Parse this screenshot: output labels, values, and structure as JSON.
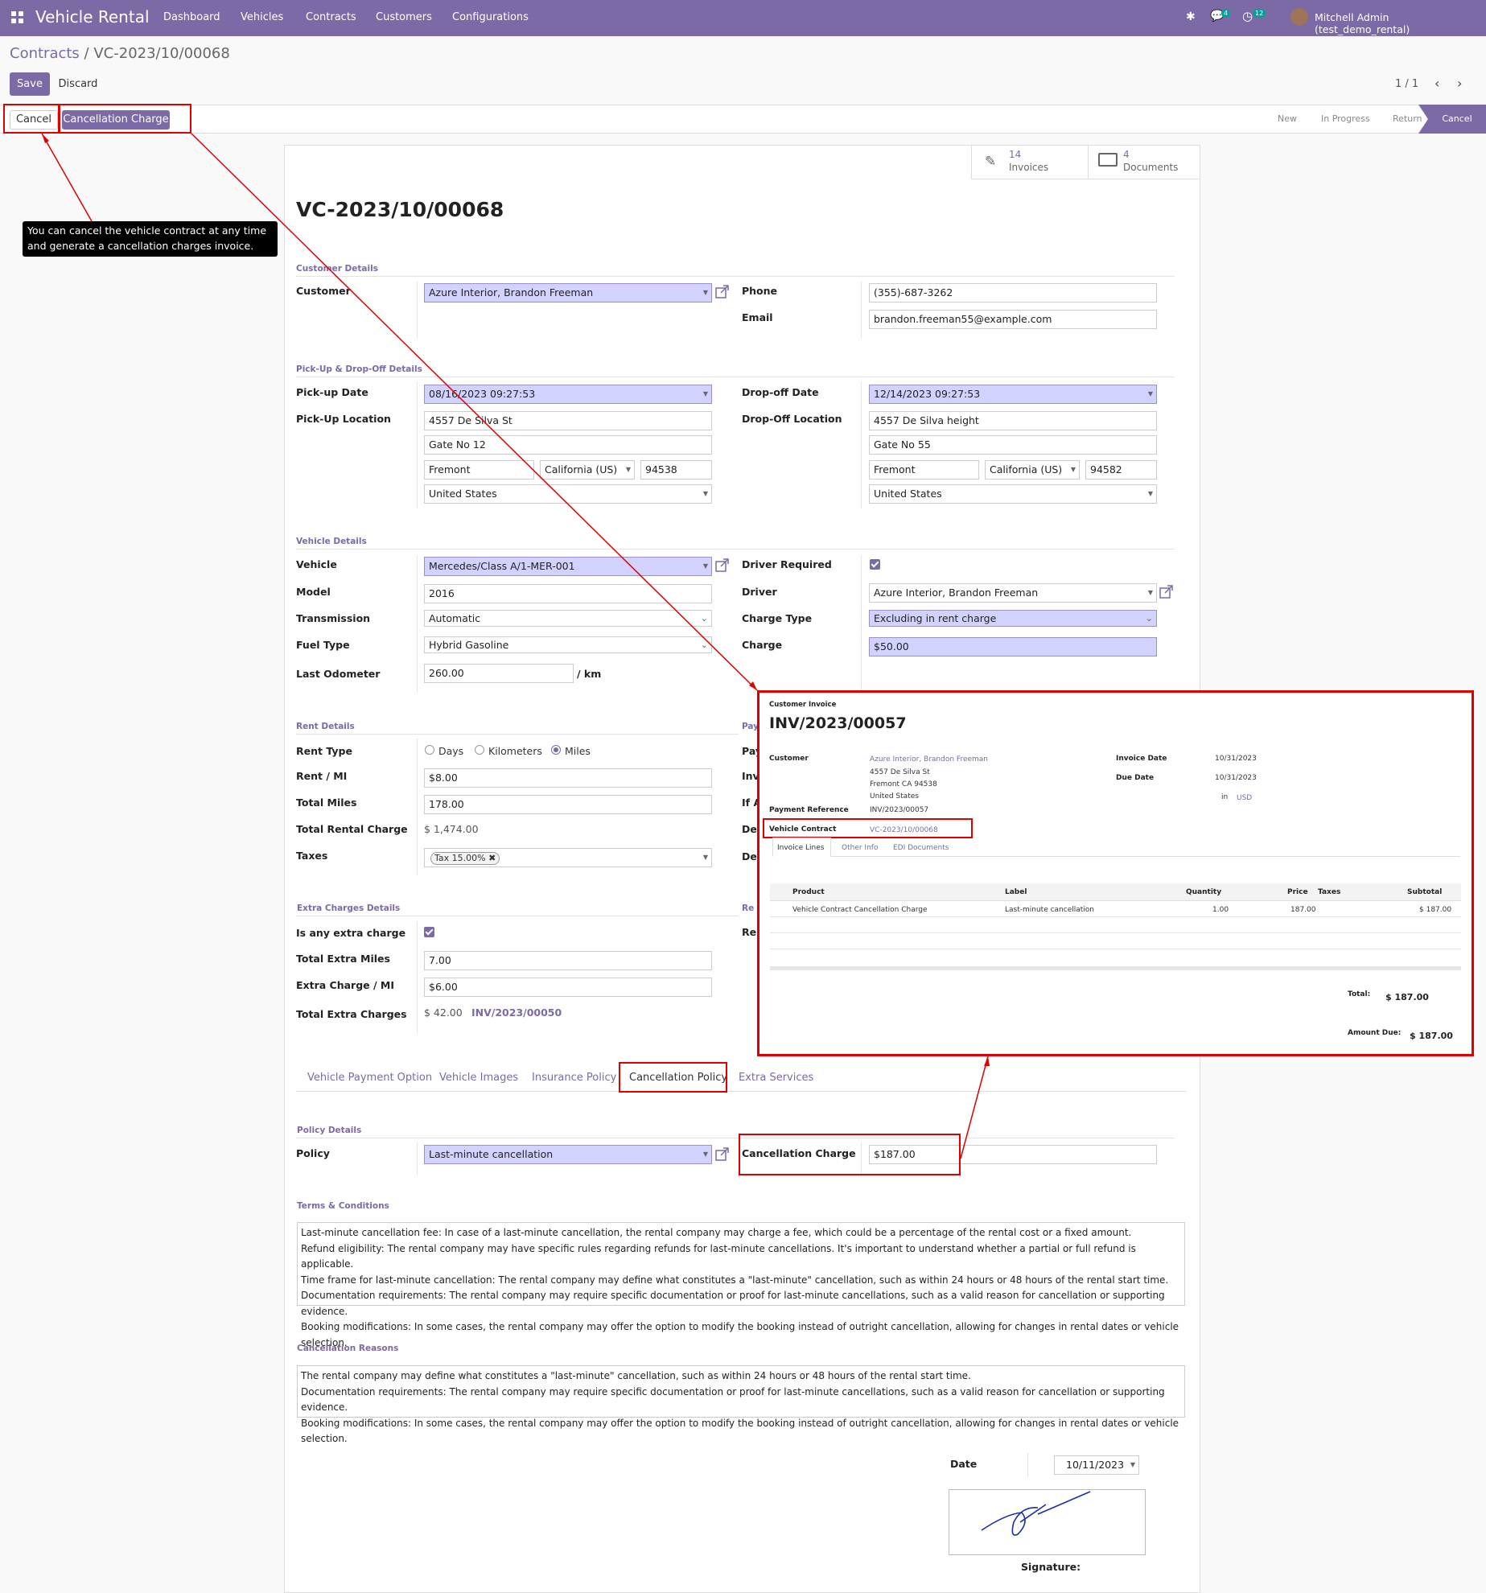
{
  "app": {
    "name": "Vehicle Rental"
  },
  "nav": {
    "menus": [
      "Dashboard",
      "Vehicles",
      "Contracts",
      "Customers",
      "Configurations"
    ],
    "messages_badge": "4",
    "activity_badge": "12",
    "user": "Mitchell Admin (test_demo_rental)"
  },
  "breadcrumb": {
    "parent": "Contracts",
    "sep": "/",
    "current": "VC-2023/10/00068"
  },
  "actions": {
    "save": "Save",
    "discard": "Discard",
    "cancel": "Cancel",
    "cancellation_charge": "Cancellation Charge"
  },
  "pager": "1 / 1",
  "stages": [
    "New",
    "In Progress",
    "Return",
    "Cancel"
  ],
  "smart_buttons": {
    "invoices_count": "14",
    "invoices_label": "Invoices",
    "documents_count": "4",
    "documents_label": "Documents"
  },
  "tooltip": "You can cancel the vehicle contract at any time and generate a cancellation charges invoice.",
  "record": {
    "title": "VC-2023/10/00068"
  },
  "customer_details": {
    "section": "Customer Details",
    "customer_label": "Customer",
    "customer": "Azure Interior, Brandon Freeman",
    "phone_label": "Phone",
    "phone": "(355)-687-3262",
    "email_label": "Email",
    "email": "brandon.freeman55@example.com"
  },
  "pickup": {
    "section": "Pick-Up & Drop-Off Details",
    "pickup_date_label": "Pick-up Date",
    "pickup_date": "08/16/2023 09:27:53",
    "pickup_loc_label": "Pick-Up Location",
    "p_street": "4557 De Silva St",
    "p_street2": "Gate No 12",
    "p_city": "Fremont",
    "p_state": "California (US)",
    "p_zip": "94538",
    "p_country": "United States",
    "drop_date_label": "Drop-off Date",
    "drop_date": "12/14/2023 09:27:53",
    "drop_loc_label": "Drop-Off Location",
    "d_street": "4557 De Silva height",
    "d_street2": "Gate No 55",
    "d_city": "Fremont",
    "d_state": "California (US)",
    "d_zip": "94582",
    "d_country": "United States"
  },
  "vehicle": {
    "section": "Vehicle Details",
    "vehicle_label": "Vehicle",
    "vehicle": "Mercedes/Class A/1-MER-001",
    "model_label": "Model",
    "model": "2016",
    "transmission_label": "Transmission",
    "transmission": "Automatic",
    "fuel_label": "Fuel Type",
    "fuel": "Hybrid Gasoline",
    "odo_label": "Last Odometer",
    "odo": "260.00",
    "odo_unit": "/ km",
    "driver_req_label": "Driver Required",
    "driver_label": "Driver",
    "driver": "Azure Interior, Brandon Freeman",
    "charge_type_label": "Charge Type",
    "charge_type": "Excluding in rent charge",
    "charge_label": "Charge",
    "charge": "$50.00"
  },
  "rent": {
    "section": "Rent Details",
    "rent_type_label": "Rent Type",
    "opt_days": "Days",
    "opt_km": "Kilometers",
    "opt_miles": "Miles",
    "rate_label": "Rent / MI",
    "rate": "$8.00",
    "total_miles_label": "Total Miles",
    "total_miles": "178.00",
    "total_rent_label": "Total Rental Charge",
    "total_rent": "$ 1,474.00",
    "taxes_label": "Taxes",
    "tax_tag": "Tax 15.00%",
    "right_cut_1": "Pay",
    "right_cut_2": "Pay",
    "right_cut_3": "Inv",
    "right_cut_4": "If A",
    "right_cut_5": "De",
    "right_cut_6": "De",
    "right_cut_7": "Re",
    "right_cut_8": "Re"
  },
  "extra": {
    "section": "Extra Charges Details",
    "is_extra_label": "Is any extra charge",
    "miles_label": "Total Extra Miles",
    "miles": "7.00",
    "rate_label": "Extra Charge / MI",
    "rate": "$6.00",
    "total_label": "Total Extra Charges",
    "total": "$ 42.00",
    "invoice_ref": "INV/2023/00050"
  },
  "tabs": [
    "Vehicle Payment Option",
    "Vehicle Images",
    "Insurance Policy",
    "Cancellation Policy",
    "Extra Services"
  ],
  "policy": {
    "section": "Policy Details",
    "policy_label": "Policy",
    "policy": "Last-minute cancellation",
    "cancel_charge_label": "Cancellation Charge",
    "cancel_charge": "$187.00"
  },
  "terms": {
    "section": "Terms & Conditions",
    "lines": [
      "Last-minute cancellation fee: In case of a last-minute cancellation, the rental company may charge a fee, which could be a percentage of the rental cost or a fixed amount.",
      "Refund eligibility: The rental company may have specific rules regarding refunds for last-minute cancellations. It's important to understand whether a partial or full refund is applicable.",
      "Time frame for last-minute cancellation: The rental company may define what constitutes a \"last-minute\" cancellation, such as within 24 hours or 48 hours of the rental start time.",
      "Documentation requirements: The rental company may require specific documentation or proof for last-minute cancellations, such as a valid reason for cancellation or supporting evidence.",
      "Booking modifications: In some cases, the rental company may offer the option to modify the booking instead of outright cancellation, allowing for changes in rental dates or vehicle selection."
    ]
  },
  "reasons": {
    "section": "Cancellation Reasons",
    "lines": [
      "The rental company may define what constitutes a \"last-minute\" cancellation, such as within 24 hours or 48 hours of the rental start time.",
      "Documentation requirements: The rental company may require specific documentation or proof for last-minute cancellations, such as a valid reason for cancellation or supporting evidence.",
      "Booking modifications: In some cases, the rental company may offer the option to modify the booking instead of outright cancellation, allowing for changes in rental dates or vehicle selection."
    ]
  },
  "signoff": {
    "date_label": "Date",
    "date": "10/11/2023",
    "signature_label": "Signature:"
  },
  "invoice": {
    "kind": "Customer Invoice",
    "number": "INV/2023/00057",
    "customer_label": "Customer",
    "customer": "Azure Interior, Brandon Freeman",
    "addr1": "4557 De Silva St",
    "addr2": "Fremont CA 94538",
    "addr3": "United States",
    "pay_ref_label": "Payment Reference",
    "pay_ref": "INV/2023/00057",
    "contract_label": "Vehicle Contract",
    "contract": "VC-2023/10/00068",
    "inv_date_label": "Invoice Date",
    "inv_date": "10/31/2023",
    "due_label": "Due Date",
    "due": "10/31/2023",
    "in": "in",
    "currency": "USD",
    "tabs": [
      "Invoice Lines",
      "Other Info",
      "EDI Documents"
    ],
    "columns": [
      "Product",
      "Label",
      "Quantity",
      "Price",
      "Taxes",
      "Subtotal"
    ],
    "line": {
      "product": "Vehicle Contract Cancellation Charge",
      "label": "Last-minute cancellation",
      "qty": "1.00",
      "price": "187.00",
      "subtotal": "$ 187.00"
    },
    "total_label": "Total:",
    "total": "$ 187.00",
    "due_amt_label": "Amount Due:",
    "due_amt": "$ 187.00"
  },
  "colors": {
    "brand": "#7b6aa5",
    "callout": "#e00000",
    "required": "#d2d2ff"
  }
}
